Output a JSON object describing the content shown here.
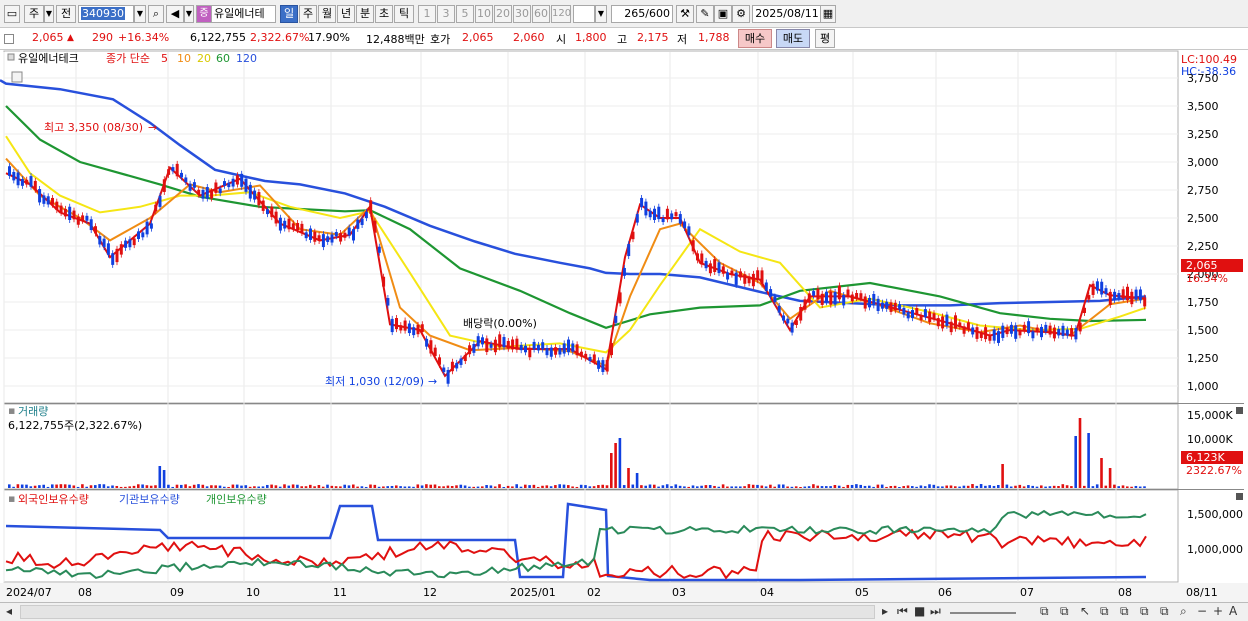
{
  "toolbar": {
    "market": "주",
    "prev": "전",
    "code": "340930",
    "name": "유일에너테",
    "badge": "증",
    "periods": [
      "일",
      "주",
      "월",
      "년",
      "분",
      "초",
      "틱"
    ],
    "minutes": [
      "1",
      "3",
      "5",
      "10",
      "20",
      "30",
      "60",
      "120"
    ],
    "count": "265",
    "count_max": "/600",
    "date": "2025/08/11"
  },
  "info": {
    "price": "2,065",
    "change": "290",
    "change_pct": "+16.34%",
    "volume": "6,122,755",
    "vol_ratio": "2,322.67%",
    "turnover": "17.90%",
    "amount": "12,488백만",
    "quote_label": "호가",
    "ask": "2,065",
    "bid": "2,060",
    "open_label": "시",
    "open": "1,800",
    "high_label": "고",
    "high": "2,175",
    "low_label": "저",
    "low": "1,788",
    "buy": "매수",
    "sell": "매도",
    "avg": "평"
  },
  "price_pane": {
    "name": "유일에너테크",
    "ma_label": "종가 단순",
    "ma_periods": [
      "5",
      "10",
      "20",
      "60",
      "120"
    ],
    "lc": "LC:100.49",
    "hc": "HC:-38.36",
    "high_note": "최고 3,350 (08/30)",
    "low_note": "최저 1,030 (12/09)",
    "div_note": "배당락(0.00%)",
    "last_price": "2,065",
    "last_pct": "16.34%",
    "yticks": [
      "3,750",
      "3,500",
      "3,250",
      "3,000",
      "2,750",
      "2,500",
      "2,250",
      "2,000",
      "1,750",
      "1,500",
      "1,250",
      "1,000"
    ]
  },
  "volume_pane": {
    "title": "거래량",
    "value": "6,122,755주(2,322.67%)",
    "yticks": [
      "15,000K",
      "10,000K",
      "5,000K"
    ],
    "last": "6,123K",
    "last_pct": "2322.67%"
  },
  "holding_pane": {
    "foreign": "외국인보유수량",
    "inst": "기관보유수량",
    "indiv": "개인보유수량",
    "yticks": [
      "1,500,000",
      "1,000,000"
    ]
  },
  "xaxis": [
    "2024/07",
    "08",
    "09",
    "10",
    "11",
    "12",
    "2025/01",
    "02",
    "03",
    "04",
    "05",
    "06",
    "07",
    "08",
    "08/11"
  ],
  "colors": {
    "up": "#e01010",
    "down": "#1040e0",
    "ma5": "#e01010",
    "ma10": "#f08c14",
    "ma20": "#f5e614",
    "ma60": "#1e9632",
    "ma120": "#2850dc"
  },
  "chart_data": {
    "type": "line",
    "ma_lines": [
      {
        "name": "120",
        "x": [
          0,
          6,
          60,
          113,
          150,
          180,
          215,
          245,
          265,
          300,
          345,
          385,
          430,
          475,
          515,
          560,
          590,
          606,
          630,
          660,
          700,
          760,
          800,
          850,
          900,
          950,
          1000,
          1050,
          1100,
          1146
        ],
        "y": [
          3730,
          3700,
          3650,
          3560,
          3350,
          3150,
          2930,
          2870,
          2830,
          2800,
          2720,
          2600,
          2430,
          2290,
          2180,
          2100,
          2050,
          2010,
          2000,
          2000,
          1970,
          1840,
          1760,
          1740,
          1720,
          1720,
          1740,
          1750,
          1760,
          1800
        ]
      },
      {
        "name": "60",
        "x": [
          6,
          40,
          80,
          160,
          200,
          260,
          300,
          345,
          370,
          410,
          460,
          520,
          570,
          606,
          650,
          700,
          760,
          800,
          870,
          940,
          1000,
          1050,
          1090,
          1146
        ],
        "y": [
          3500,
          3200,
          3000,
          2800,
          2690,
          2600,
          2580,
          2560,
          2570,
          2400,
          2050,
          1850,
          1650,
          1520,
          1640,
          1700,
          1720,
          1850,
          1920,
          1800,
          1650,
          1600,
          1580,
          1590
        ]
      },
      {
        "name": "20",
        "x": [
          6,
          30,
          60,
          100,
          140,
          180,
          210,
          250,
          290,
          340,
          370,
          410,
          450,
          500,
          560,
          606,
          630,
          660,
          700,
          740,
          780,
          820,
          870,
          930,
          980,
          1030,
          1080,
          1120,
          1146
        ],
        "y": [
          3230,
          2900,
          2700,
          2550,
          2600,
          2700,
          2700,
          2730,
          2600,
          2500,
          2560,
          2010,
          1450,
          1350,
          1380,
          1300,
          1500,
          1900,
          2400,
          2200,
          2100,
          1700,
          1780,
          1660,
          1540,
          1500,
          1510,
          1620,
          1700
        ]
      },
      {
        "name": "10",
        "x": [
          6,
          40,
          80,
          110,
          150,
          190,
          220,
          260,
          300,
          340,
          370,
          400,
          430,
          470,
          520,
          570,
          606,
          630,
          660,
          680,
          720,
          760,
          790,
          830,
          880,
          930,
          980,
          1020,
          1070,
          1110,
          1146
        ],
        "y": [
          3030,
          2700,
          2500,
          2300,
          2500,
          2800,
          2730,
          2790,
          2400,
          2350,
          2600,
          1700,
          1450,
          1320,
          1340,
          1310,
          1180,
          1800,
          2400,
          2450,
          2100,
          1920,
          1600,
          1850,
          1720,
          1560,
          1480,
          1540,
          1450,
          1730,
          1780
        ]
      },
      {
        "name": "5",
        "x": [
          6,
          30,
          60,
          90,
          110,
          150,
          170,
          200,
          240,
          280,
          320,
          350,
          370,
          390,
          420,
          445,
          480,
          520,
          570,
          606,
          625,
          640,
          660,
          680,
          700,
          730,
          760,
          790,
          810,
          850,
          900,
          950,
          990,
          1010,
          1050,
          1075,
          1090,
          1110,
          1146
        ],
        "y": [
          2900,
          2800,
          2550,
          2450,
          2150,
          2450,
          2950,
          2700,
          2850,
          2450,
          2300,
          2350,
          2600,
          1550,
          1500,
          1090,
          1400,
          1330,
          1330,
          1150,
          2150,
          2620,
          2500,
          2500,
          2100,
          2000,
          1950,
          1500,
          1800,
          1800,
          1680,
          1560,
          1450,
          1500,
          1480,
          1450,
          1900,
          1810,
          1780
        ]
      }
    ]
  }
}
